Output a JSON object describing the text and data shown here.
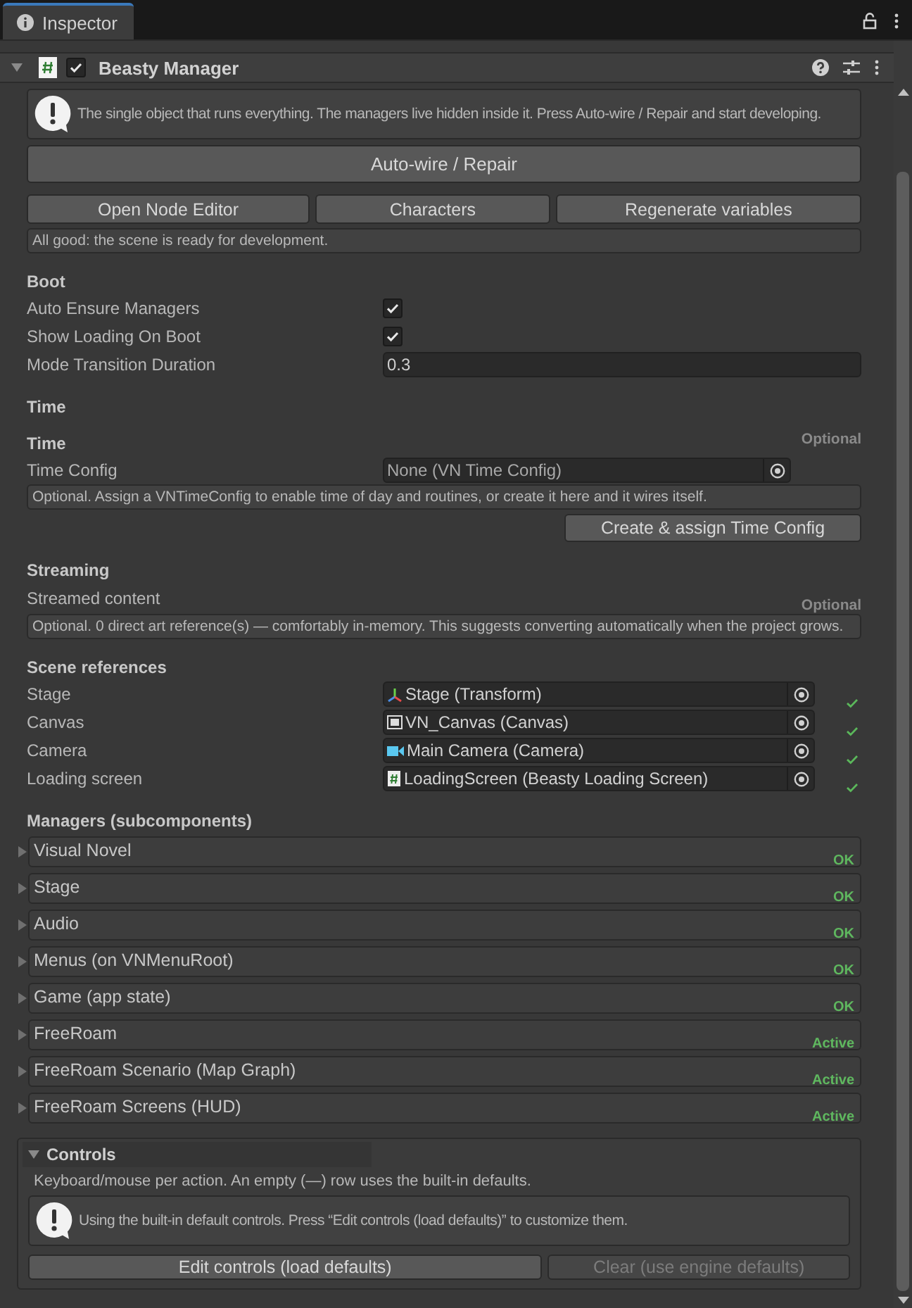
{
  "tab": {
    "title": "Inspector"
  },
  "component": {
    "name": "Beasty Manager",
    "enabled": true,
    "expanded": true
  },
  "intro_help": "The single object that runs everything. The managers live hidden inside it. Press Auto-wire / Repair and start developing.",
  "primary_button": "Auto-wire / Repair",
  "buttons": [
    "Open Node Editor",
    "Characters",
    "Regenerate variables"
  ],
  "status": "All good: the scene is ready for development.",
  "items": [
    {
      "kind": "heading",
      "text": "Boot"
    },
    {
      "kind": "checkbox",
      "label": "Auto Ensure Managers",
      "checked": true
    },
    {
      "kind": "checkbox",
      "label": "Show Loading On Boot",
      "checked": true
    },
    {
      "kind": "number",
      "label": "Mode Transition Duration",
      "value": "0.3"
    },
    {
      "kind": "heading",
      "text": "Time"
    },
    {
      "kind": "heading",
      "text": "Time",
      "tag": "Optional"
    },
    {
      "kind": "object",
      "label": "Time Config",
      "value": "None (VN Time Config)",
      "valid": false
    },
    {
      "kind": "help",
      "text": "Optional. Assign a VNTimeConfig to enable time of day and routines, or create it here and it wires itself."
    },
    {
      "kind": "button",
      "label": "Create & assign Time Config"
    },
    {
      "kind": "heading",
      "text": "Streaming"
    },
    {
      "kind": "label",
      "label": "Streamed content",
      "tag": "Optional"
    },
    {
      "kind": "help",
      "text": "Optional. 0 direct art reference(s) — comfortably in-memory. This suggests converting automatically when the project grows."
    },
    {
      "kind": "heading",
      "text": "Scene references"
    },
    {
      "kind": "object",
      "label": "Stage",
      "value": "Stage (Transform)",
      "valid": true
    },
    {
      "kind": "object",
      "label": "Canvas",
      "value": "VN_Canvas (Canvas)",
      "valid": true
    },
    {
      "kind": "object",
      "label": "Camera",
      "value": "Main Camera (Camera)",
      "valid": true
    },
    {
      "kind": "object",
      "label": "Loading screen",
      "value": "LoadingScreen (Beasty Loading Screen)",
      "valid": true
    },
    {
      "kind": "heading",
      "text": "Managers (subcomponents)"
    },
    {
      "kind": "foldout",
      "label": "Visual Novel",
      "status": "OK",
      "expanded": false
    },
    {
      "kind": "foldout",
      "label": "Stage",
      "status": "OK",
      "expanded": false
    },
    {
      "kind": "foldout",
      "label": "Audio",
      "status": "OK",
      "expanded": false
    },
    {
      "kind": "foldout",
      "label": "Menus (on VNMenuRoot)",
      "status": "OK",
      "expanded": false
    },
    {
      "kind": "foldout",
      "label": "Game (app state)",
      "status": "OK",
      "expanded": false
    },
    {
      "kind": "foldout",
      "label": "FreeRoam",
      "status": "Active",
      "expanded": false
    },
    {
      "kind": "foldout",
      "label": "FreeRoam Scenario (Map Graph)",
      "status": "Active",
      "expanded": false
    },
    {
      "kind": "foldout",
      "label": "FreeRoam Screens (HUD)",
      "status": "Active",
      "expanded": false
    }
  ],
  "controls": {
    "title": "Controls",
    "expanded": true,
    "description": "Keyboard/mouse per action. An empty (—) row uses the built-in defaults.",
    "help": "Using the built-in default controls. Press “Edit controls (load defaults)” to customize them.",
    "buttons": [
      {
        "label": "Edit controls (load defaults)",
        "disabled": false
      },
      {
        "label": "Clear (use engine defaults)",
        "disabled": true
      }
    ]
  }
}
